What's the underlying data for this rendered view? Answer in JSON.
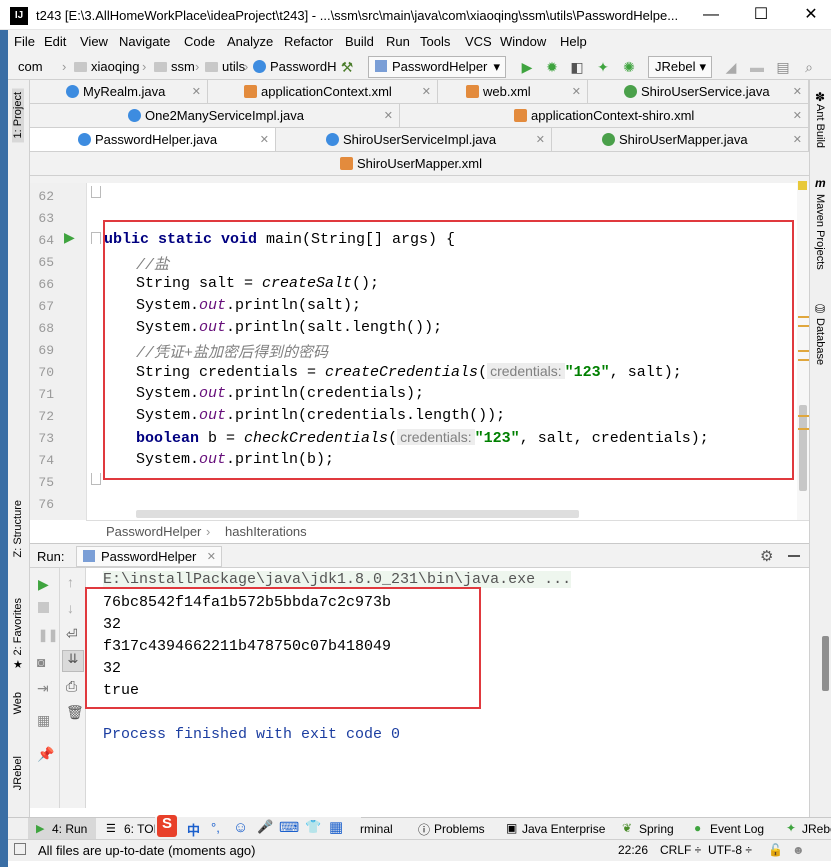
{
  "window": {
    "title": "t243 [E:\\3.AllHomeWorkPlace\\ideaProject\\t243] - ...\\ssm\\src\\main\\java\\com\\xiaoqing\\ssm\\utils\\PasswordHelpe...",
    "logo": "IJ",
    "minimize": "—",
    "maximize": "☐",
    "close": "✕"
  },
  "menu": [
    "File",
    "Edit",
    "View",
    "Navigate",
    "Code",
    "Analyze",
    "Refactor",
    "Build",
    "Run",
    "Tools",
    "VCS",
    "Window",
    "Help"
  ],
  "breadcrumb": [
    "com",
    "xiaoqing",
    "ssm",
    "utils",
    "PasswordH"
  ],
  "toolbar": {
    "run_config": "PasswordHelper",
    "jrebel": "JRebel"
  },
  "left_tools": {
    "project": "1: Project",
    "structure": "Z: Structure",
    "favorites": "2: Favorites",
    "web": "Web",
    "jrebel": "JRebel"
  },
  "right_tools": {
    "ant": "Ant Build",
    "maven": "Maven Projects",
    "database": "Database"
  },
  "tabs": {
    "row1": [
      "MyRealm.java",
      "applicationContext.xml",
      "web.xml",
      "ShiroUserService.java"
    ],
    "row2": [
      "One2ManyServiceImpl.java",
      "applicationContext-shiro.xml"
    ],
    "row3": [
      "PasswordHelper.java",
      "ShiroUserServiceImpl.java",
      "ShiroUserMapper.java"
    ],
    "row4": [
      "ShiroUserMapper.xml"
    ]
  },
  "editor": {
    "line_numbers": [
      "62",
      "63",
      "64",
      "65",
      "66",
      "67",
      "68",
      "69",
      "70",
      "71",
      "72",
      "73",
      "74",
      "75",
      "76"
    ],
    "l64": {
      "kw1": "ublic static void ",
      "rest": "main(String[] args) {"
    },
    "l65": "//盐",
    "l66": {
      "a": "String salt = ",
      "b": "createSalt",
      "c": "();"
    },
    "l67": {
      "a": "System.",
      "b": "out",
      "c": ".println(salt);"
    },
    "l68": {
      "a": "System.",
      "b": "out",
      "c": ".println(salt.length());"
    },
    "l69": "//凭证+盐加密后得到的密码",
    "l70": {
      "a": "String credentials = ",
      "b": "createCredentials",
      "c": "(",
      "hint": "credentials:",
      "s": "\"123\"",
      "d": ", salt);"
    },
    "l71": {
      "a": "System.",
      "b": "out",
      "c": ".println(credentials);"
    },
    "l72": {
      "a": "System.",
      "b": "out",
      "c": ".println(credentials.length());"
    },
    "l73": {
      "kw": "boolean ",
      "a": "b = ",
      "b": "checkCredentials",
      "c": "(",
      "hint": "credentials:",
      "s": "\"123\"",
      "d": ", salt, credentials);"
    },
    "l74": {
      "a": "System.",
      "b": "out",
      "c": ".println(b);"
    }
  },
  "code_breadcrumb": [
    "PasswordHelper",
    "hashIterations"
  ],
  "run": {
    "label": "Run:",
    "tab": "PasswordHelper",
    "command": "E:\\installPackage\\java\\jdk1.8.0_231\\bin\\java.exe ...",
    "output": [
      "76bc8542f14fa1b572b5bbda7c2c973b",
      "32",
      "f317c4394662211b478750c07b418049",
      "32",
      "true"
    ],
    "exit": "Process finished with exit code 0"
  },
  "bottom_tabs": [
    "4: Run",
    "6: TOD",
    "rminal",
    "Problems",
    "Java Enterprise",
    "Spring",
    "Event Log",
    "JRebe"
  ],
  "ime": [
    "S",
    "中",
    "°,",
    "☺",
    "🎤",
    "⌨",
    "👕",
    "▦"
  ],
  "status": {
    "message": "All files are up-to-date (moments ago)",
    "position": "22:26",
    "line_sep": "CRLF ÷",
    "encoding": "UTF-8 ÷"
  },
  "colors": {
    "highlight_box": "#e0393e",
    "keyword": "#000080",
    "string": "#008000",
    "field": "#660e7a",
    "comment": "#808080"
  }
}
